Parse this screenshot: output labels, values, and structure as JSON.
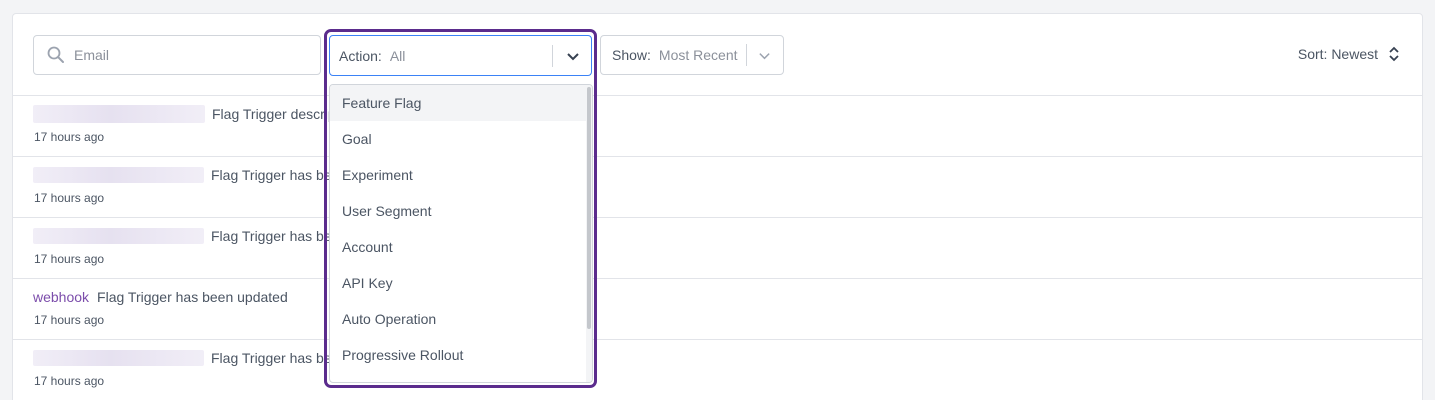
{
  "filters": {
    "email_placeholder": "Email",
    "action": {
      "label": "Action:",
      "value": "All",
      "options": [
        "Feature Flag",
        "Goal",
        "Experiment",
        "User Segment",
        "Account",
        "API Key",
        "Auto Operation",
        "Progressive Rollout"
      ],
      "highlighted": "Feature Flag"
    },
    "show": {
      "label": "Show:",
      "value": "Most Recent"
    },
    "sort": {
      "label": "Sort: Newest"
    }
  },
  "rows": [
    {
      "actor": "",
      "text": "Flag Trigger description has been changed",
      "time": "17 hours ago"
    },
    {
      "actor": "",
      "text": "Flag Trigger has been updated",
      "time": "17 hours ago"
    },
    {
      "actor": "",
      "text": "Flag Trigger has been updated",
      "time": "17 hours ago"
    },
    {
      "actor": "webhook",
      "text": "Flag Trigger has been updated",
      "time": "17 hours ago"
    },
    {
      "actor": "",
      "text": "Flag Trigger has been updated",
      "time": "17 hours ago"
    }
  ],
  "colors": {
    "accent_border": "#5b2c8d",
    "focus_border": "#3b82f6",
    "actor_link": "#7c4dab"
  }
}
